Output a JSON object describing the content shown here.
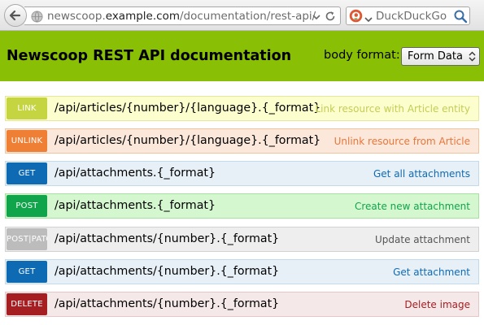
{
  "browser": {
    "url_prefix": "newscoop.",
    "url_host": "example.com",
    "url_path": "/documentation/rest-api/",
    "search_engine": "DuckDuckGo"
  },
  "header": {
    "title": "Newscoop REST API documentation",
    "format_label": "body format:",
    "format_value": "Form Data"
  },
  "colors": {
    "header_bg": "#89bf04",
    "link": "#c5d541",
    "unlink": "#ef7f35",
    "get": "#0f6ab4",
    "post": "#10a54a",
    "post_put": "#bcbcbc",
    "delete": "#a41e22"
  },
  "endpoints": [
    {
      "method": "LINK",
      "path": "/api/articles/{number}/{language}.{_format}",
      "desc": "Link resource with Article entity",
      "badge": "#c5d541",
      "bg": "#fcffcd",
      "border": "#e5e89a",
      "desc_color": "#c3cd55"
    },
    {
      "method": "UNLINK",
      "path": "/api/articles/{number}/{language}.{_format}",
      "desc": "Unlink resource from Article",
      "badge": "#ef7f35",
      "bg": "#fbe8db",
      "border": "#f1c49e",
      "desc_color": "#e9763a"
    },
    {
      "method": "GET",
      "path": "/api/attachments.{_format}",
      "desc": "Get all attachments",
      "badge": "#0f6ab4",
      "bg": "#e7f0f7",
      "border": "#c3d9ec",
      "desc_color": "#0f6ab4"
    },
    {
      "method": "POST",
      "path": "/api/attachments.{_format}",
      "desc": "Create new attachment",
      "badge": "#10a54a",
      "bg": "#d5f7d0",
      "border": "#a7e1a1",
      "desc_color": "#10a54a"
    },
    {
      "method": "POST|PATCH",
      "path": "/api/attachments/{number}.{_format}",
      "desc": "Update attachment",
      "badge": "#bcbcbc",
      "bg": "#eeeeee",
      "border": "#d2d2d2",
      "desc_color": "#555555"
    },
    {
      "method": "GET",
      "path": "/api/attachments/{number}.{_format}",
      "desc": "Get attachment",
      "badge": "#0f6ab4",
      "bg": "#e7f0f7",
      "border": "#c3d9ec",
      "desc_color": "#0f6ab4"
    },
    {
      "method": "DELETE",
      "path": "/api/attachments/{number}.{_format}",
      "desc": "Delete image",
      "badge": "#a41e22",
      "bg": "#f5e8e8",
      "border": "#e8c6c7",
      "desc_color": "#a41e22"
    }
  ]
}
